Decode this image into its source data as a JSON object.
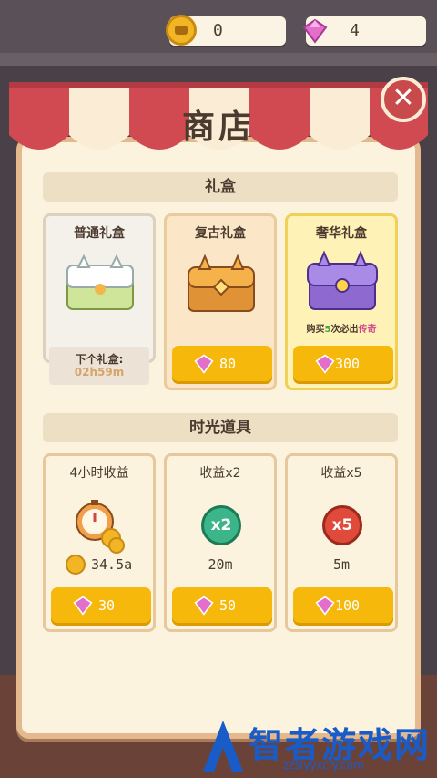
{
  "topbar": {
    "coins": "0",
    "gems": "4"
  },
  "shop": {
    "title": "商店",
    "sections": {
      "gift_boxes": "礼盒",
      "time_items": "时光道具"
    },
    "gift_boxes": [
      {
        "name": "普通礼盒",
        "next_label": "下个礼盒:",
        "timer": "02h59m"
      },
      {
        "name": "复古礼盒",
        "price": "80"
      },
      {
        "name": "奢华礼盒",
        "promo_prefix": "购买",
        "promo_num": "5",
        "promo_mid": "次必出",
        "promo_highlight": "传奇",
        "price": "300"
      }
    ],
    "time_items": [
      {
        "name": "4小时收益",
        "value": "34.5a",
        "price": "30"
      },
      {
        "name": "收益x2",
        "badge": "x2",
        "duration": "20m",
        "price": "50"
      },
      {
        "name": "收益x5",
        "badge": "x5",
        "duration": "5m",
        "price": "100"
      }
    ]
  },
  "watermark": {
    "title": "智者游戏网",
    "url": "zzslyyxcfy.com"
  },
  "colors": {
    "accent": "#f6b90b",
    "close": "#c84a4a",
    "legend": "#d04a8a"
  }
}
